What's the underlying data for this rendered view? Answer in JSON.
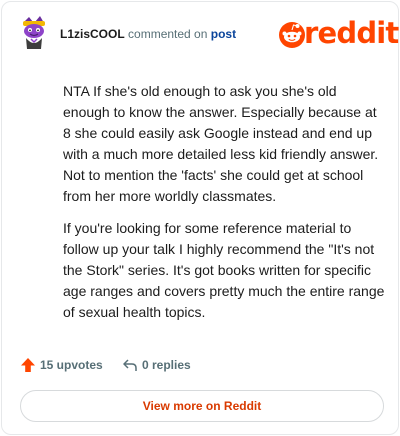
{
  "comment": {
    "username": "L1zisCOOL",
    "action_text": "commented on",
    "post_link_label": "post",
    "paragraphs": [
      "NTA If she's old enough to ask you she's old enough to know the answer. Especially because at 8 she could easily ask Google instead and end up with a much more detailed less kid friendly answer. Not to mention the 'facts' she could get at school from her more worldly classmates.",
      "If you're looking for some reference material to follow up your talk I highly recommend the \"It's not the Stork\" series. It's got books written for specific age ranges and covers pretty much the entire range of sexual health topics."
    ]
  },
  "brand": {
    "wordmark": "reddit",
    "color": "#ff4500"
  },
  "actions": {
    "upvotes_label": "15 upvotes",
    "replies_label": "0 replies"
  },
  "view_more_label": "View more on Reddit",
  "icons": {
    "avatar": "snoo-avatar-purple",
    "brand_logo": "reddit-snoo-logo",
    "upvote": "upvote-arrow-icon",
    "reply": "reply-arrow-icon"
  },
  "colors": {
    "accent": "#ff4500",
    "link": "#0a449b",
    "button_text": "#d93a00",
    "muted": "#576f76"
  }
}
